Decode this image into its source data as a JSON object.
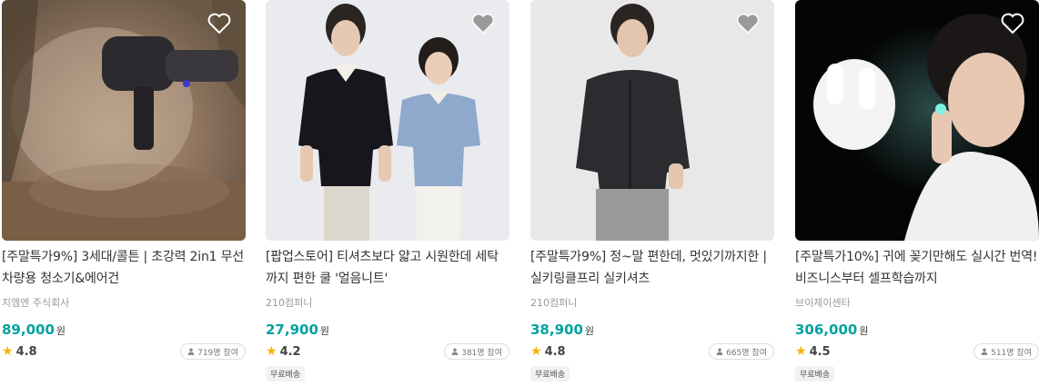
{
  "products": [
    {
      "title": "[주말특가9%] 3세대/콜튼 | 초강력 2in1 무선 차량용 청소기&에어건",
      "maker": "지엠엔 주식회사",
      "price": "89,000",
      "currency": "원",
      "rating": "4.8",
      "participants": "719명 참여",
      "badge": "",
      "image_desc": "blower-gun-dust"
    },
    {
      "title": "[팝업스토어] 티셔츠보다 얇고 시원한데 세탁까지 편한 쿨 '얼음니트'",
      "maker": "210컴퍼니",
      "price": "27,900",
      "currency": "원",
      "rating": "4.2",
      "participants": "381명 참여",
      "badge": "무료배송",
      "image_desc": "knit-couple"
    },
    {
      "title": "[주말특가9%] 정~말 편한데, 멋있기까지한 | 실키링클프리 실키셔츠",
      "maker": "210컴퍼니",
      "price": "38,900",
      "currency": "원",
      "rating": "4.8",
      "participants": "665명 참여",
      "badge": "무료배송",
      "image_desc": "black-shirt-model"
    },
    {
      "title": "[주말특가10%] 귀에 꽂기만해도 실시간 번역! 비즈니스부터 셀프학습까지",
      "maker": "브이제이센타",
      "price": "306,000",
      "currency": "원",
      "rating": "4.5",
      "participants": "511명 참여",
      "badge": "무료배송",
      "image_desc": "translation-earbuds"
    }
  ],
  "colors": {
    "price": "#00a2a0",
    "star": "#f5b400"
  },
  "icons": {
    "wishlist": "heart-icon",
    "rating": "star-icon",
    "participants": "person-icon"
  }
}
